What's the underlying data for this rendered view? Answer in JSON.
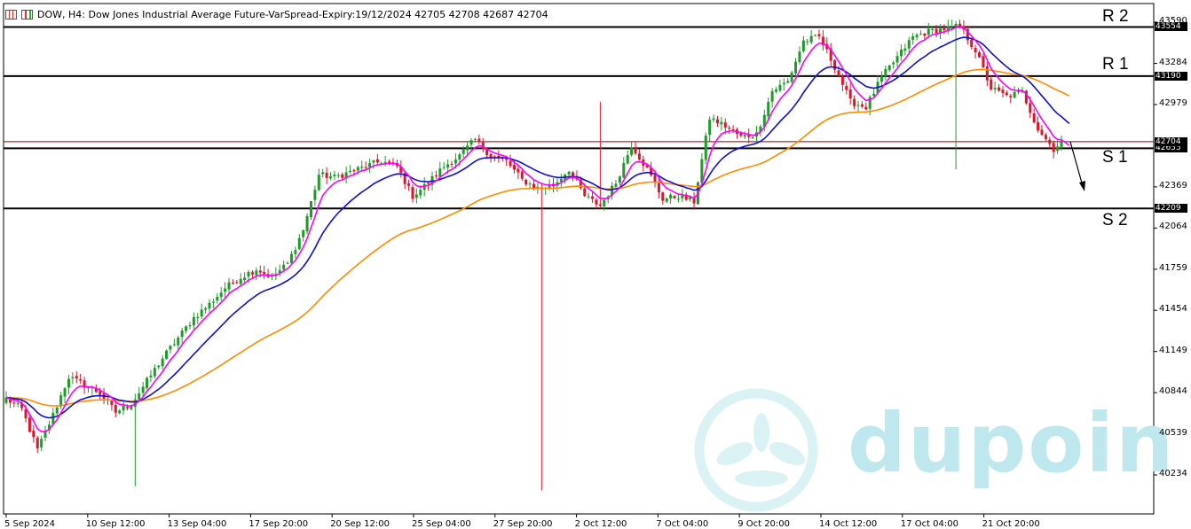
{
  "header": {
    "symbol_line": "DOW, H4:  Dow Jones Industrial Average Future-VarSpread-Expiry:19/12/2024  42705 42708 42687 42704"
  },
  "watermark": {
    "text": "dupoin"
  },
  "colors": {
    "bull": "#1f9b2a",
    "bear": "#e0142a",
    "ma_fast": "#ff00ff",
    "ma_mid": "#1010cc",
    "ma_slow": "#ff8c00",
    "level_line": "#000000",
    "current_price_line": "#8b0000",
    "watermark": "#bfe8ee"
  },
  "chart_data": {
    "type": "candlestick",
    "timeframe": "H4",
    "ylim": [
      40080,
      43620
    ],
    "y_ticks": [
      {
        "value": 43590,
        "label": "43590"
      },
      {
        "value": 43284,
        "label": "43284"
      },
      {
        "value": 42979,
        "label": "42979"
      },
      {
        "value": 42369,
        "label": "42369"
      },
      {
        "value": 42064,
        "label": "42064"
      },
      {
        "value": 41759,
        "label": "41759"
      },
      {
        "value": 41454,
        "label": "41454"
      },
      {
        "value": 41149,
        "label": "41149"
      },
      {
        "value": 40844,
        "label": "40844"
      },
      {
        "value": 40539,
        "label": "40539"
      },
      {
        "value": 40234,
        "label": "40234"
      }
    ],
    "x_ticks": [
      "5 Sep 2024",
      "10 Sep 12:00",
      "13 Sep 04:00",
      "17 Sep 20:00",
      "20 Sep 12:00",
      "25 Sep 04:00",
      "27 Sep 20:00",
      "2 Oct 12:00",
      "7 Oct 04:00",
      "9 Oct 20:00",
      "14 Oct 12:00",
      "17 Oct 04:00",
      "21 Oct 20:00"
    ],
    "levels": [
      {
        "name": "R 2",
        "value": 43554,
        "tag": "43554"
      },
      {
        "name": "R 1",
        "value": 43190,
        "tag": "43190"
      },
      {
        "name": "S 1",
        "value": 42655,
        "tag": "42655"
      },
      {
        "name": "S 2",
        "value": 42209,
        "tag": "42209"
      }
    ],
    "current_price": {
      "value": 42704,
      "tag": "42704"
    },
    "anchors": [
      [
        0,
        40800
      ],
      [
        4,
        40720
      ],
      [
        8,
        40420
      ],
      [
        12,
        40680
      ],
      [
        16,
        40960
      ],
      [
        20,
        40900
      ],
      [
        24,
        40840
      ],
      [
        28,
        40700
      ],
      [
        32,
        40760
      ],
      [
        36,
        40930
      ],
      [
        40,
        41100
      ],
      [
        44,
        41250
      ],
      [
        48,
        41400
      ],
      [
        52,
        41500
      ],
      [
        56,
        41620
      ],
      [
        60,
        41700
      ],
      [
        64,
        41760
      ],
      [
        68,
        41700
      ],
      [
        72,
        41800
      ],
      [
        76,
        42050
      ],
      [
        80,
        42460
      ],
      [
        84,
        42440
      ],
      [
        88,
        42480
      ],
      [
        92,
        42520
      ],
      [
        96,
        42560
      ],
      [
        100,
        42520
      ],
      [
        104,
        42300
      ],
      [
        108,
        42400
      ],
      [
        112,
        42520
      ],
      [
        116,
        42600
      ],
      [
        120,
        42720
      ],
      [
        124,
        42600
      ],
      [
        128,
        42560
      ],
      [
        132,
        42420
      ],
      [
        136,
        42360
      ],
      [
        140,
        42380
      ],
      [
        144,
        42500
      ],
      [
        148,
        42300
      ],
      [
        152,
        42230
      ],
      [
        156,
        42400
      ],
      [
        160,
        42680
      ],
      [
        164,
        42500
      ],
      [
        168,
        42280
      ],
      [
        172,
        42300
      ],
      [
        176,
        42260
      ],
      [
        180,
        42880
      ],
      [
        184,
        42820
      ],
      [
        188,
        42740
      ],
      [
        192,
        42760
      ],
      [
        196,
        43080
      ],
      [
        200,
        43150
      ],
      [
        204,
        43450
      ],
      [
        208,
        43480
      ],
      [
        212,
        43260
      ],
      [
        216,
        43000
      ],
      [
        220,
        42960
      ],
      [
        224,
        43180
      ],
      [
        228,
        43330
      ],
      [
        232,
        43480
      ],
      [
        236,
        43520
      ],
      [
        240,
        43540
      ],
      [
        244,
        43560
      ],
      [
        248,
        43380
      ],
      [
        252,
        43100
      ],
      [
        256,
        43040
      ],
      [
        260,
        43070
      ],
      [
        264,
        42800
      ],
      [
        268,
        42650
      ],
      [
        270,
        42704
      ]
    ]
  },
  "levels_labels": {
    "R2": "R 2",
    "R1": "R 1",
    "S1": "S 1",
    "S2": "S 2"
  }
}
